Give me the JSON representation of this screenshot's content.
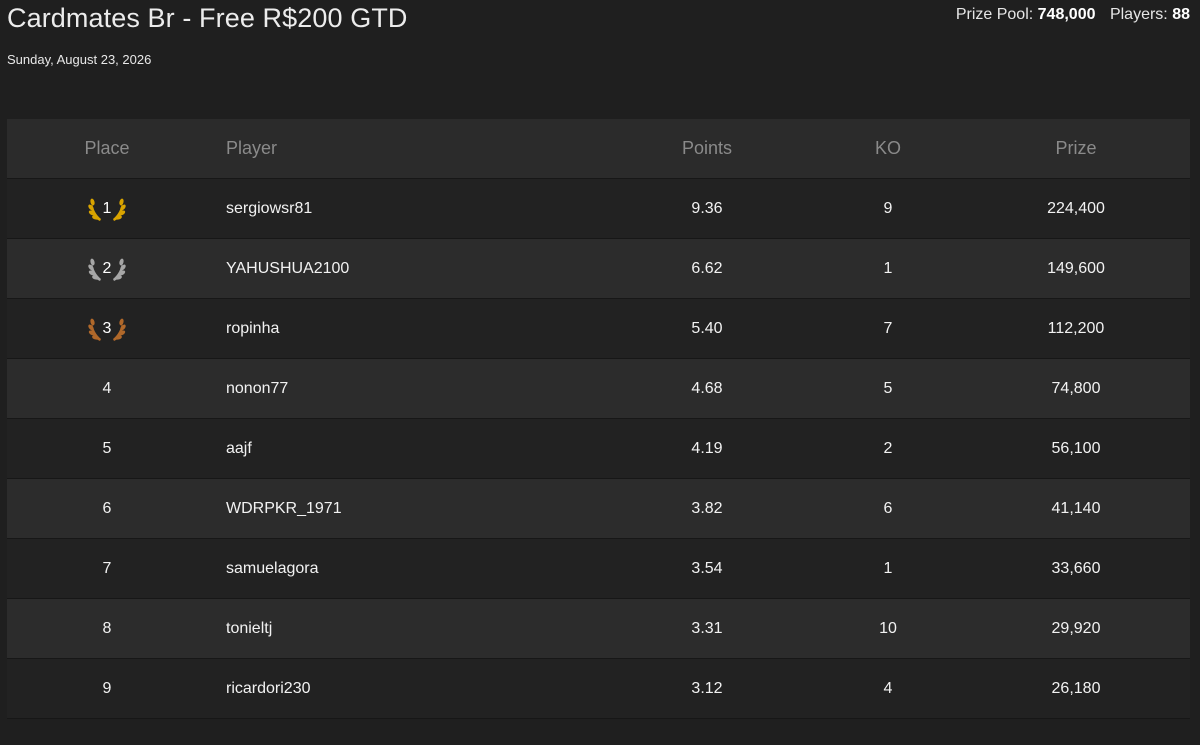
{
  "header": {
    "title": "Cardmates Br - Free R$200 GTD",
    "date": "Sunday, August 23, 2026",
    "prize_pool_label": "Prize Pool:",
    "prize_pool_value": "748,000",
    "players_label": "Players:",
    "players_value": "88"
  },
  "table": {
    "columns": {
      "place": "Place",
      "player": "Player",
      "points": "Points",
      "ko": "KO",
      "prize": "Prize"
    },
    "rows": [
      {
        "place": "1",
        "player": "sergiowsr81",
        "points": "9.36",
        "ko": "9",
        "prize": "224,400",
        "medal": "gold"
      },
      {
        "place": "2",
        "player": "YAHUSHUA2100",
        "points": "6.62",
        "ko": "1",
        "prize": "149,600",
        "medal": "silver"
      },
      {
        "place": "3",
        "player": "ropinha",
        "points": "5.40",
        "ko": "7",
        "prize": "112,200",
        "medal": "bronze"
      },
      {
        "place": "4",
        "player": "nonon77",
        "points": "4.68",
        "ko": "5",
        "prize": "74,800"
      },
      {
        "place": "5",
        "player": "aajf",
        "points": "4.19",
        "ko": "2",
        "prize": "56,100"
      },
      {
        "place": "6",
        "player": "WDRPKR_1971",
        "points": "3.82",
        "ko": "6",
        "prize": "41,140"
      },
      {
        "place": "7",
        "player": "samuelagora",
        "points": "3.54",
        "ko": "1",
        "prize": "33,660"
      },
      {
        "place": "8",
        "player": "tonieltj",
        "points": "3.31",
        "ko": "10",
        "prize": "29,920"
      },
      {
        "place": "9",
        "player": "ricardori230",
        "points": "3.12",
        "ko": "4",
        "prize": "26,180"
      }
    ]
  },
  "colors": {
    "gold": "#d9a400",
    "silver": "#a6a6a6",
    "bronze": "#b0682a"
  }
}
